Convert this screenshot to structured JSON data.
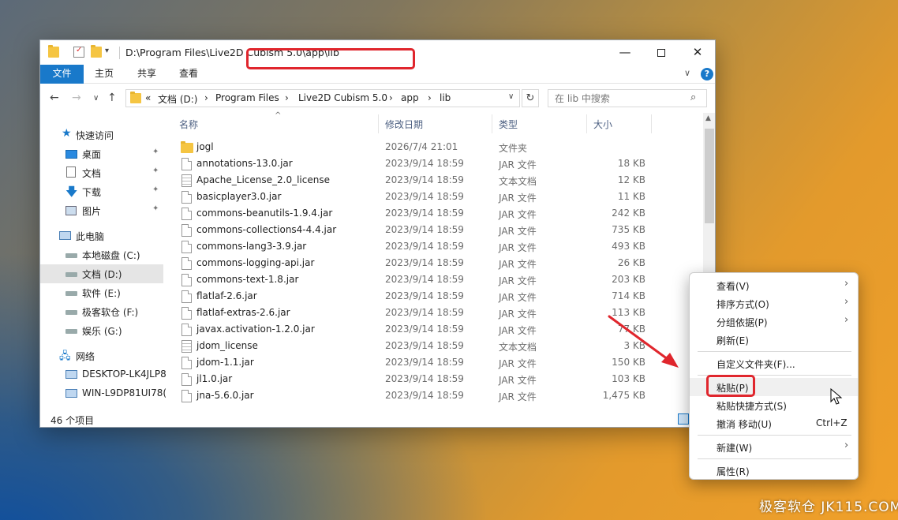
{
  "window": {
    "title": "D:\\Program Files\\Live2D Cubism 5.0\\app\\lib",
    "controls": {
      "minimize": "—",
      "maximize": "",
      "close": "✕"
    }
  },
  "ribbon": {
    "tabs": [
      "文件",
      "主页",
      "共享",
      "查看"
    ],
    "expand": "∨",
    "help": "?"
  },
  "nav": {
    "back": "←",
    "forward": "→",
    "recent": "∨",
    "up": "↑",
    "breadcrumb": [
      "«",
      "文档 (D:)",
      "›",
      "Program Files",
      "›",
      "Live2D Cubism 5.0",
      "›",
      "app",
      "›",
      "lib"
    ],
    "dropdown": "∨",
    "refresh": "↻",
    "search_placeholder": "在 lib 中搜索",
    "search_icon": "⌕"
  },
  "sidebar": {
    "items": [
      {
        "label": "快速访问",
        "icon": "star-icon",
        "pinned": false
      },
      {
        "label": "桌面",
        "icon": "desktop-icon",
        "pinned": true
      },
      {
        "label": "文档",
        "icon": "documents-icon",
        "pinned": true
      },
      {
        "label": "下载",
        "icon": "download-icon",
        "pinned": true
      },
      {
        "label": "图片",
        "icon": "pictures-icon",
        "pinned": true
      },
      {
        "label": "此电脑",
        "icon": "this-pc-icon",
        "pinned": false
      },
      {
        "label": "本地磁盘 (C:)",
        "icon": "drive-icon",
        "pinned": false
      },
      {
        "label": "文档 (D:)",
        "icon": "drive-icon",
        "pinned": false,
        "selected": true
      },
      {
        "label": "软件 (E:)",
        "icon": "drive-icon",
        "pinned": false
      },
      {
        "label": "极客软仓 (F:)",
        "icon": "drive-icon",
        "pinned": false
      },
      {
        "label": "娱乐 (G:)",
        "icon": "drive-icon",
        "pinned": false
      },
      {
        "label": "网络",
        "icon": "network-icon",
        "pinned": false
      },
      {
        "label": "DESKTOP-LK4JLP8",
        "icon": "computer-icon",
        "pinned": false
      },
      {
        "label": "WIN-L9DP81UI78(",
        "icon": "computer-icon",
        "pinned": false
      }
    ],
    "pin_glyph": "📌"
  },
  "columns": {
    "name": "名称",
    "date": "修改日期",
    "type": "类型",
    "size": "大小",
    "sort_arrow": "^"
  },
  "files": [
    {
      "name": "jogl",
      "date": "2026/7/4 21:01",
      "type": "文件夹",
      "size": "",
      "kind": "folder"
    },
    {
      "name": "annotations-13.0.jar",
      "date": "2023/9/14 18:59",
      "type": "JAR 文件",
      "size": "18 KB",
      "kind": "file"
    },
    {
      "name": "Apache_License_2.0_license",
      "date": "2023/9/14 18:59",
      "type": "文本文档",
      "size": "12 KB",
      "kind": "text"
    },
    {
      "name": "basicplayer3.0.jar",
      "date": "2023/9/14 18:59",
      "type": "JAR 文件",
      "size": "11 KB",
      "kind": "file"
    },
    {
      "name": "commons-beanutils-1.9.4.jar",
      "date": "2023/9/14 18:59",
      "type": "JAR 文件",
      "size": "242 KB",
      "kind": "file"
    },
    {
      "name": "commons-collections4-4.4.jar",
      "date": "2023/9/14 18:59",
      "type": "JAR 文件",
      "size": "735 KB",
      "kind": "file"
    },
    {
      "name": "commons-lang3-3.9.jar",
      "date": "2023/9/14 18:59",
      "type": "JAR 文件",
      "size": "493 KB",
      "kind": "file"
    },
    {
      "name": "commons-logging-api.jar",
      "date": "2023/9/14 18:59",
      "type": "JAR 文件",
      "size": "26 KB",
      "kind": "file"
    },
    {
      "name": "commons-text-1.8.jar",
      "date": "2023/9/14 18:59",
      "type": "JAR 文件",
      "size": "203 KB",
      "kind": "file"
    },
    {
      "name": "flatlaf-2.6.jar",
      "date": "2023/9/14 18:59",
      "type": "JAR 文件",
      "size": "714 KB",
      "kind": "file"
    },
    {
      "name": "flatlaf-extras-2.6.jar",
      "date": "2023/9/14 18:59",
      "type": "JAR 文件",
      "size": "113 KB",
      "kind": "file"
    },
    {
      "name": "javax.activation-1.2.0.jar",
      "date": "2023/9/14 18:59",
      "type": "JAR 文件",
      "size": "77 KB",
      "kind": "file"
    },
    {
      "name": "jdom_license",
      "date": "2023/9/14 18:59",
      "type": "文本文档",
      "size": "3 KB",
      "kind": "text"
    },
    {
      "name": "jdom-1.1.jar",
      "date": "2023/9/14 18:59",
      "type": "JAR 文件",
      "size": "150 KB",
      "kind": "file"
    },
    {
      "name": "jl1.0.jar",
      "date": "2023/9/14 18:59",
      "type": "JAR 文件",
      "size": "103 KB",
      "kind": "file"
    },
    {
      "name": "jna-5.6.0.jar",
      "date": "2023/9/14 18:59",
      "type": "JAR 文件",
      "size": "1,475 KB",
      "kind": "file"
    }
  ],
  "status": {
    "count": "46 个项目"
  },
  "context_menu": {
    "items": [
      {
        "label": "查看(V)",
        "submenu": true
      },
      {
        "label": "排序方式(O)",
        "submenu": true
      },
      {
        "label": "分组依据(P)",
        "submenu": true
      },
      {
        "label": "刷新(E)",
        "submenu": false
      },
      {
        "sep": true
      },
      {
        "label": "自定义文件夹(F)...",
        "submenu": false
      },
      {
        "sep": true
      },
      {
        "label": "粘贴(P)",
        "submenu": false,
        "hover": true
      },
      {
        "label": "粘贴快捷方式(S)",
        "submenu": false
      },
      {
        "label": "撤消 移动(U)",
        "submenu": false,
        "shortcut": "Ctrl+Z"
      },
      {
        "sep": true
      },
      {
        "label": "新建(W)",
        "submenu": true
      },
      {
        "sep": true
      },
      {
        "label": "属性(R)",
        "submenu": false
      }
    ],
    "arrow_glyph": "›"
  },
  "watermark": "极客软仓 JK115.COM",
  "colors": {
    "accent": "#1979ca",
    "highlight": "#e0262d"
  }
}
